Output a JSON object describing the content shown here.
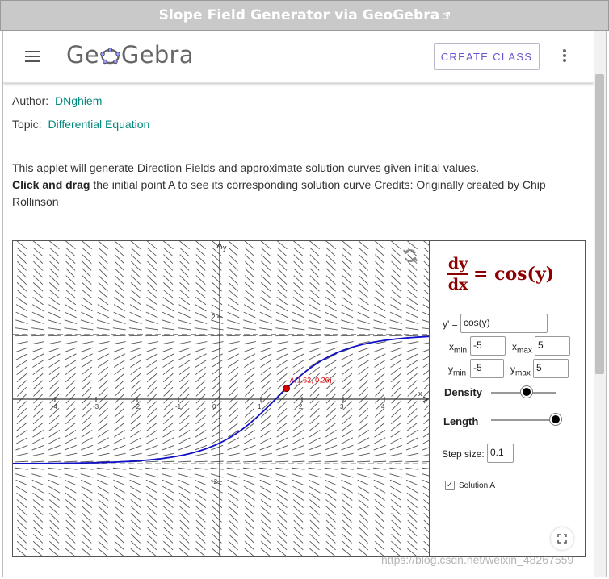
{
  "window": {
    "title": "Slope Field Generator via GeoGebra"
  },
  "header": {
    "logo": "GeoGebra",
    "create_class": "CREATE CLASS"
  },
  "meta": {
    "author_label": "Author:",
    "author": "DNghiem",
    "topic_label": "Topic:",
    "topic": "Differential Equation"
  },
  "description": {
    "line1": "This applet will generate Direction Fields and approximate solution curves given initial values.",
    "bold": "Click and drag",
    "rest": " the initial point A to see its corresponding solution curve  Credits:  Originally created by Chip Rollinson"
  },
  "graph": {
    "axis_y": "y",
    "axis_x": "x",
    "x_ticks": [
      "-4",
      "-3",
      "-2",
      "-1",
      "0",
      "1",
      "2",
      "3",
      "4"
    ],
    "y_ticks": [
      "4",
      "2",
      "-2",
      "-4"
    ],
    "point_label": "A(1.62, 0.26)",
    "colors": {
      "curve": "#1010c8",
      "point": "#d40000",
      "slopes": "#555555"
    }
  },
  "panel": {
    "formula_num": "dy",
    "formula_den": "dx",
    "formula_rhs": "= cos(y)",
    "yprime_label": "y' =",
    "yprime_value": "cos(y)",
    "xmin_value": "-5",
    "xmax_value": "5",
    "ymin_value": "-5",
    "ymax_value": "5",
    "density_label": "Density",
    "length_label": "Length",
    "density_level": 0.55,
    "length_level": 1.0,
    "step_label": "Step size:",
    "step_value": "0.1",
    "solution_label": "Solution A",
    "solution_checked": "✓"
  },
  "watermark": "https://blog.csdn.net/weixin_48267559"
}
